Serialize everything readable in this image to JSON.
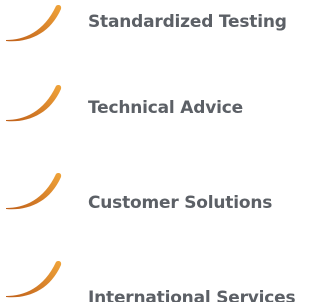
{
  "colors": {
    "accent": "#e5932c",
    "accent_dark": "#c0611a",
    "text": "#5c6066"
  },
  "icon_name": "swoosh-icon",
  "items": [
    {
      "label": "Standardized Testing"
    },
    {
      "label": "Technical Advice"
    },
    {
      "label": "Customer Solutions"
    },
    {
      "label": "International Services"
    }
  ]
}
